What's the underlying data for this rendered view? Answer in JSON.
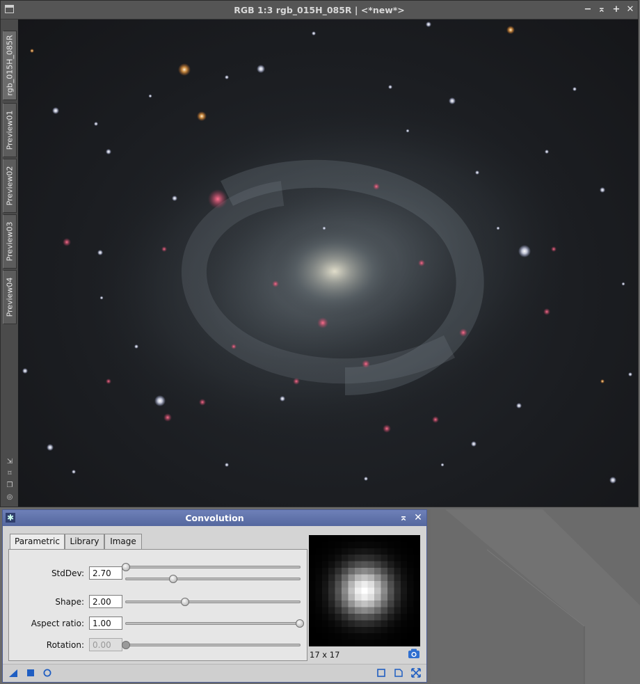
{
  "image_window": {
    "title": "RGB 1:3 rgb_015H_085R | <*new*>",
    "buttons": {
      "minimize": "−",
      "shade": "⌅",
      "maximize": "+",
      "close": "✕"
    },
    "tabs": [
      {
        "label": "rgb_015H_085R",
        "active": true
      },
      {
        "label": "Preview01",
        "active": false
      },
      {
        "label": "Preview02",
        "active": false
      },
      {
        "label": "Preview03",
        "active": false
      },
      {
        "label": "Preview04",
        "active": false
      }
    ],
    "side_tools": [
      "zoom-arrow-icon",
      "fit-icon",
      "duplicate-icon",
      "target-icon"
    ]
  },
  "convolution": {
    "title": "Convolution",
    "tabs": [
      "Parametric",
      "Library",
      "Image"
    ],
    "active_tab": "Parametric",
    "params": {
      "stddev": {
        "label": "StdDev:",
        "value": "2.70",
        "coarse_fraction": 0.0,
        "fine_fraction": 0.27
      },
      "shape": {
        "label": "Shape:",
        "value": "2.00",
        "fraction": 0.34
      },
      "aspect_ratio": {
        "label": "Aspect ratio:",
        "value": "1.00",
        "fraction": 1.0
      },
      "rotation": {
        "label": "Rotation:",
        "value": "0.00",
        "fraction": 0.0,
        "disabled": true
      }
    },
    "kernel_size": "17 x 17",
    "footer_icons": [
      "new-instance-icon",
      "apply-global-icon",
      "reset-icon",
      "preview-icon",
      "document-icon",
      "expand-icon"
    ]
  },
  "colors": {
    "dialog_title_bg": "#5a6da4",
    "image_title_bg": "#555555",
    "canvas_bg": "#1b1d21"
  }
}
